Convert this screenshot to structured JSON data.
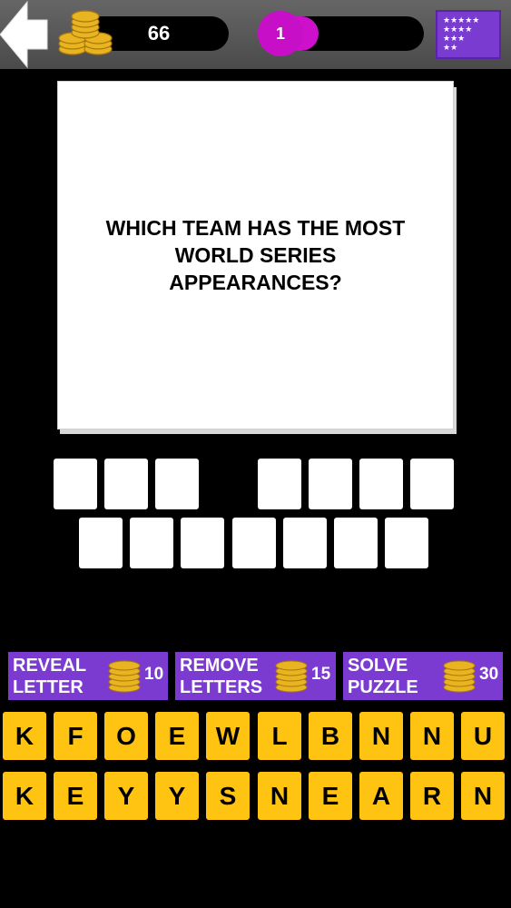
{
  "header": {
    "back_icon": "back-arrow-icon",
    "coins": "66",
    "coin_icon": "coin-stack-icon",
    "level": "1",
    "level_progress": 0.2,
    "stars_icon": "star-grid-icon"
  },
  "question": {
    "text": "WHICH TEAM HAS THE MOST WORLD SERIES APPEARANCES?"
  },
  "answer": {
    "word_lengths": [
      3,
      4,
      7
    ],
    "filled": []
  },
  "hints": [
    {
      "label": "REVEAL\nLETTER",
      "cost": "10"
    },
    {
      "label": "REMOVE\nLETTERS",
      "cost": "15"
    },
    {
      "label": "SOLVE\nPUZZLE",
      "cost": "30"
    }
  ],
  "keyboard": {
    "row1": [
      "K",
      "F",
      "O",
      "E",
      "W",
      "L",
      "B",
      "N",
      "N",
      "U"
    ],
    "row2": [
      "K",
      "E",
      "Y",
      "Y",
      "S",
      "N",
      "E",
      "A",
      "R",
      "N"
    ]
  },
  "colors": {
    "accent_purple": "#7b3bd0",
    "level_magenta": "#c80fc8",
    "tile_yellow": "#ffc312",
    "coin_gold": "#e8b422"
  }
}
